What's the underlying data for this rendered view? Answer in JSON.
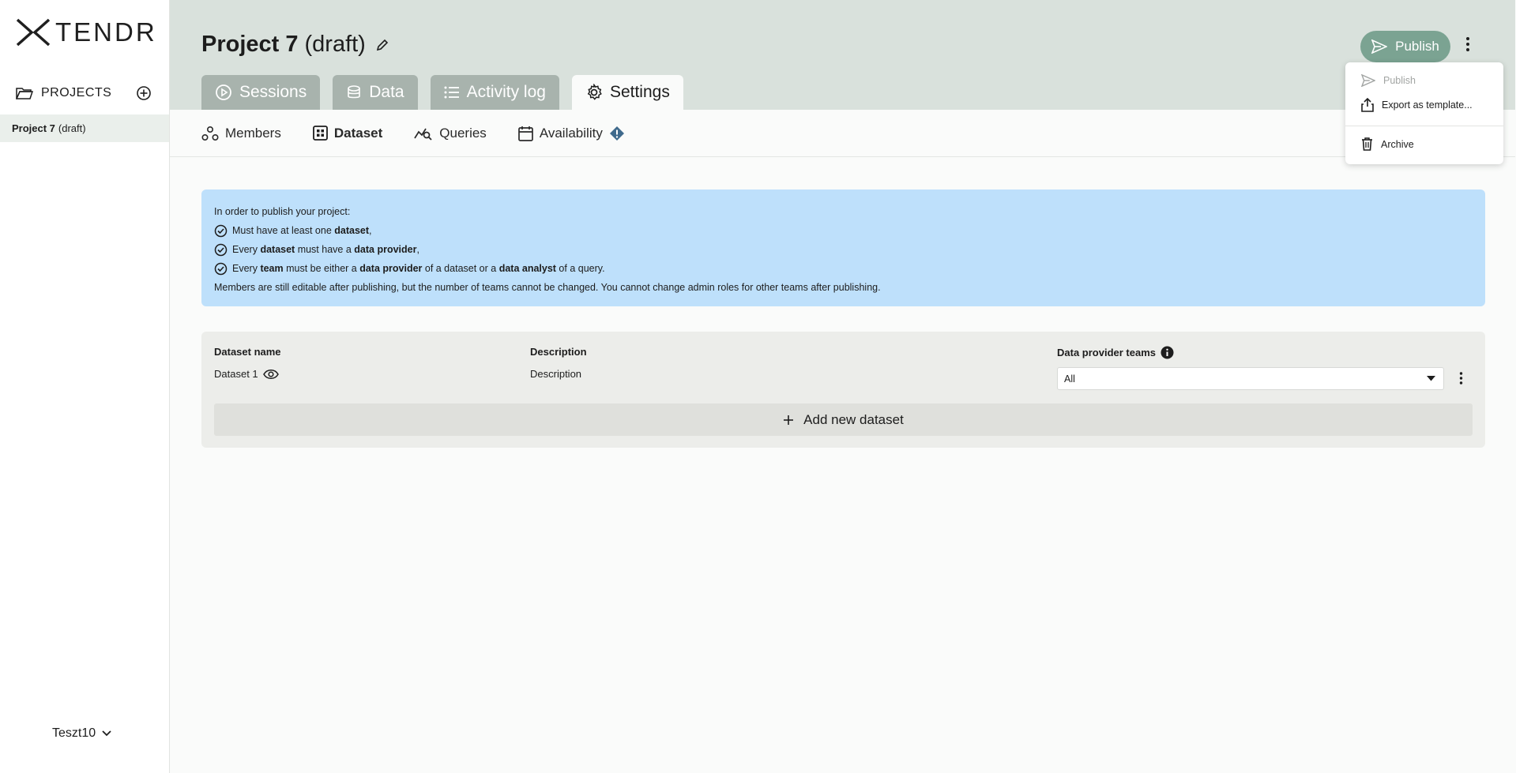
{
  "brand": {
    "logo_text": "TENDR",
    "accent_color": "#7ba392",
    "info_color": "#bee0fb"
  },
  "sidebar": {
    "projects_label": "PROJECTS",
    "project": {
      "name": "Project 7",
      "status": "(draft)"
    },
    "user": "Teszt10"
  },
  "header": {
    "title": "Project 7",
    "title_suffix": "(draft)",
    "publish_label": "Publish",
    "tabs": [
      {
        "label": "Sessions",
        "icon": "play-circle-icon"
      },
      {
        "label": "Data",
        "icon": "database-icon"
      },
      {
        "label": "Activity log",
        "icon": "list-icon"
      },
      {
        "label": "Settings",
        "icon": "gear-icon"
      }
    ]
  },
  "subnav": {
    "items": [
      {
        "label": "Members",
        "icon": "members-icon"
      },
      {
        "label": "Dataset",
        "icon": "dataset-icon"
      },
      {
        "label": "Queries",
        "icon": "queries-icon"
      },
      {
        "label": "Availability",
        "icon": "calendar-icon"
      }
    ]
  },
  "info": {
    "intro": "In order to publish your project:",
    "r1": {
      "a": "Must have at least one ",
      "b": "dataset",
      "c": ","
    },
    "r2": {
      "a": "Every ",
      "b": "dataset",
      "c": " must have a ",
      "d": "data provider",
      "e": ","
    },
    "r3": {
      "a": "Every ",
      "b": "team",
      "c": " must be either a ",
      "d": "data provider",
      "e": " of a dataset or a ",
      "f": "data analyst",
      "g": " of a query."
    },
    "note": "Members are still editable after publishing, but the number of teams cannot be changed. You cannot change admin roles for other teams after publishing."
  },
  "dataset_table": {
    "headers": {
      "name": "Dataset name",
      "description": "Description",
      "providers": "Data provider teams"
    },
    "rows": [
      {
        "name": "Dataset 1",
        "description": "Description",
        "providers": "All"
      }
    ],
    "add_label": "Add new dataset"
  },
  "menu": {
    "items": [
      {
        "label": "Publish",
        "disabled": true
      },
      {
        "label": "Export as template..."
      },
      {
        "label": "Archive"
      }
    ]
  }
}
